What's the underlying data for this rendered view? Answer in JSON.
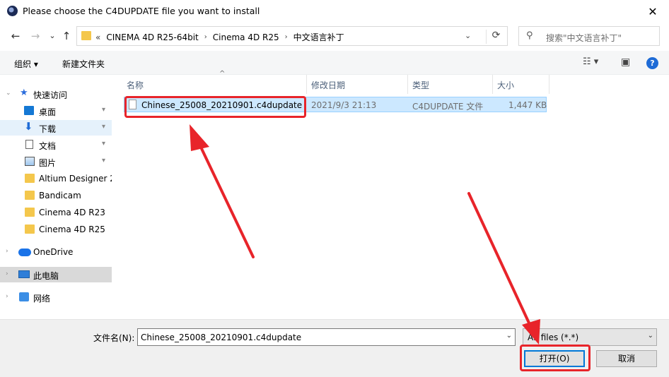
{
  "window": {
    "title": "Please choose the C4DUPDATE file you want to install",
    "close_glyph": "✕"
  },
  "navigation": {
    "back_glyph": "←",
    "forward_glyph": "→",
    "recent_glyph": "⌄",
    "up_glyph": "↑",
    "overflow_glyph": "«",
    "breadcrumbs": [
      "CINEMA 4D R25-64bit",
      "Cinema 4D R25",
      "中文语言补丁"
    ],
    "separator": "›",
    "dropdown_glyph": "⌄",
    "refresh_glyph": "⟳"
  },
  "search": {
    "icon": "search-icon",
    "glyph": "⚲",
    "placeholder": "搜索\"中文语言补丁\""
  },
  "toolbar": {
    "organize": "组织 ▾",
    "new_folder": "新建文件夹",
    "view_glyph": "☷ ▾",
    "preview_glyph": "▣",
    "help": "?"
  },
  "sidebar": {
    "quick_access": "快速访问",
    "items": [
      {
        "label": "桌面",
        "icon": "desktop-icon",
        "pinned": true
      },
      {
        "label": "下载",
        "icon": "download-icon",
        "pinned": true
      },
      {
        "label": "文档",
        "icon": "document-icon",
        "pinned": true
      },
      {
        "label": "图片",
        "icon": "pictures-icon",
        "pinned": true
      },
      {
        "label": "Altium Designer 2",
        "icon": "folder-icon",
        "pinned": false
      },
      {
        "label": "Bandicam",
        "icon": "folder-icon",
        "pinned": false
      },
      {
        "label": "Cinema 4D R23",
        "icon": "folder-icon",
        "pinned": false
      },
      {
        "label": "Cinema 4D R25",
        "icon": "folder-icon",
        "pinned": false
      }
    ],
    "onedrive": "OneDrive",
    "this_pc": "此电脑",
    "network": "网络",
    "pin_glyph": "📌",
    "expand_glyph": "›",
    "expanded_glyph": "⌄"
  },
  "columns": {
    "name": "名称",
    "date": "修改日期",
    "type": "类型",
    "size": "大小",
    "sort_glyph": "^"
  },
  "files": [
    {
      "name": "Chinese_25008_20210901.c4dupdate",
      "date": "2021/9/3 21:13",
      "type": "C4DUPDATE 文件",
      "size": "1,447 KB"
    }
  ],
  "footer": {
    "filename_label": "文件名(N):",
    "filename_value": "Chinese_25008_20210901.c4dupdate",
    "filetype_value": "All files (*.*)",
    "open_button": "打开(O)",
    "cancel_button": "取消"
  },
  "colors": {
    "highlight": "#e8242a",
    "selection": "#cce8ff",
    "accent": "#0078d7"
  }
}
